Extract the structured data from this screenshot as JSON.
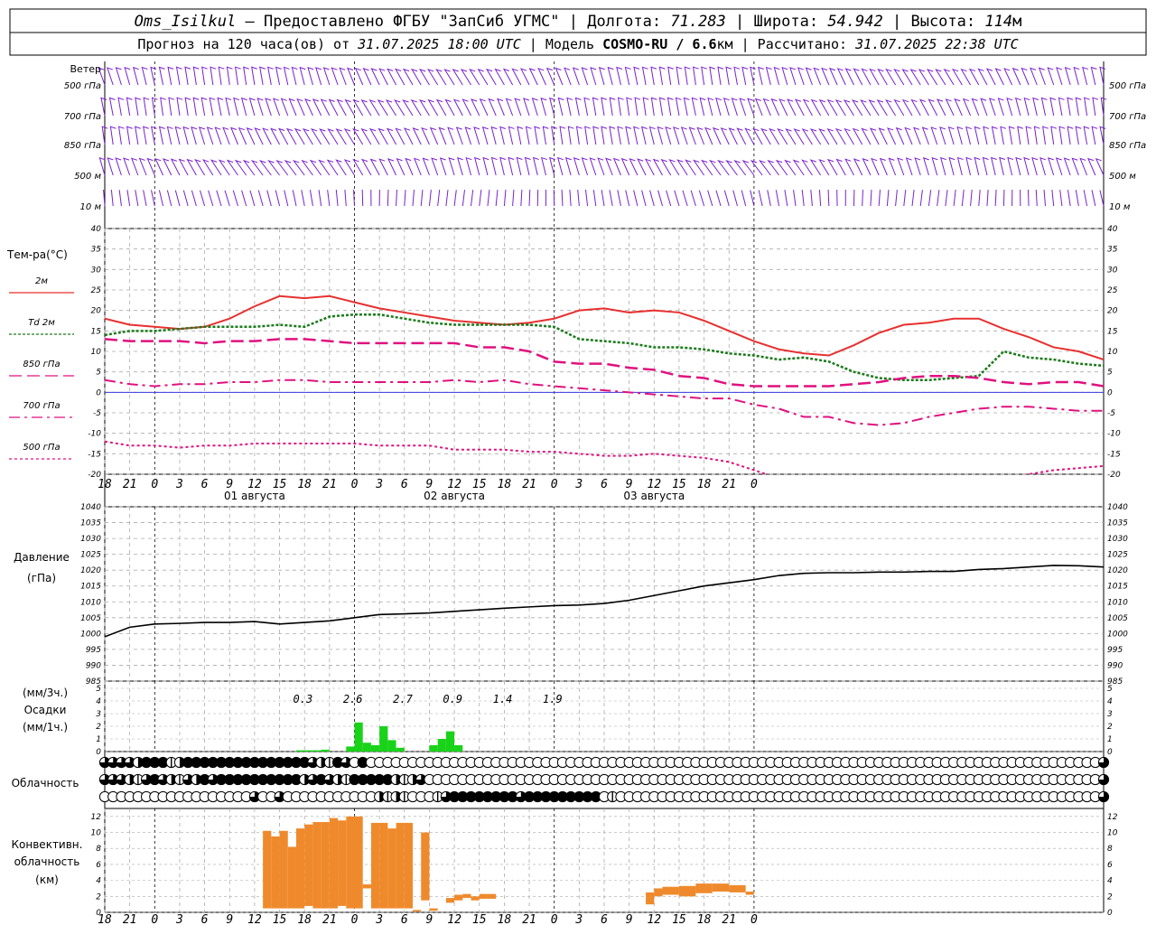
{
  "header": {
    "line1": {
      "station": "Oms_Isilkul",
      "provider": " – Предоставлено ФГБУ \"ЗапСиб УГМС\" | ",
      "lon_label": "Долгота: ",
      "lon_value": "71.283",
      "lat_label": " | Широта: ",
      "lat_value": "54.942",
      "alt_label": " | Высота: ",
      "alt_value": "114",
      "alt_unit": "м"
    },
    "line2": {
      "forecast_label": "Прогноз на 120 часа(ов) от ",
      "forecast_start": "31.07.2025 18:00 UTC",
      "model_label": "  | Модель ",
      "model_name": "COSMO-RU / 6.6",
      "model_unit": "км",
      "calc_label": " | Рассчитано: ",
      "calc_time": "31.07.2025 22:38 UTC"
    }
  },
  "colors": {
    "wind": "#7a1fd0",
    "t2m": "#e83030",
    "td2m": "#1a7a1a",
    "t850": "#e0117f",
    "t700": "#e0117f",
    "t500": "#e0117f",
    "zero_line": "#3a3ae0",
    "pressure": "#000000",
    "precip": "#19d319",
    "convective": "#ef8a2c",
    "grid": "#aaaaaa"
  },
  "time_axis": {
    "ticks": [
      "18",
      "21",
      "0",
      "3",
      "6",
      "9",
      "12",
      "15",
      "18",
      "21",
      "0",
      "3",
      "6",
      "9",
      "12",
      "15",
      "18",
      "21",
      "0",
      "3",
      "6",
      "9",
      "12",
      "15",
      "18",
      "21",
      "0"
    ],
    "day_labels": [
      "01 августа",
      "02 августа",
      "03 августа"
    ]
  },
  "wind_panel": {
    "title": "Ветер",
    "levels": [
      "500 гПа",
      "700 гПа",
      "850 гПа",
      "500 м",
      "10 м"
    ]
  },
  "temp_panel": {
    "title": "Тем-ра(°С)",
    "legend": [
      {
        "label": "2м",
        "style": "solid"
      },
      {
        "label": "Td 2м",
        "style": "dotted"
      },
      {
        "label": "850 гПа",
        "style": "dash"
      },
      {
        "label": "700 гПа",
        "style": "dashdot"
      },
      {
        "label": "500 гПа",
        "style": "fine"
      }
    ]
  },
  "pressure_panel": {
    "title_line1": "Давление",
    "title_line2": "(гПа)"
  },
  "precip_panel": {
    "label_line1": "(мм/3ч.)",
    "label_line2": "Осадки",
    "label_line3": "(мм/1ч.)",
    "totals": [
      "0.3",
      "2.6",
      "2.7",
      "0.9",
      "1.4",
      "1.9"
    ]
  },
  "cloud_panel": {
    "title": "Облачность"
  },
  "conv_panel": {
    "title_line1": "Конвективн.",
    "title_line2": "облачность",
    "title_line3": "(км)"
  },
  "chart_data": [
    {
      "type": "line",
      "title": "Тем-ра(°С)",
      "x_hours": [
        0,
        3,
        6,
        9,
        12,
        15,
        18,
        21,
        24,
        27,
        30,
        33,
        36,
        39,
        42,
        45,
        48,
        51,
        54,
        57,
        60,
        63,
        66,
        69,
        72,
        75,
        78,
        81,
        84,
        87,
        90,
        93,
        96,
        99,
        102,
        105,
        108,
        111,
        114,
        117,
        120
      ],
      "ylim": [
        -20,
        40
      ],
      "yticks": [
        -20,
        -15,
        -10,
        -5,
        0,
        5,
        10,
        15,
        20,
        25,
        30,
        35,
        40
      ],
      "series": [
        {
          "name": "2м",
          "values": [
            18,
            16.5,
            16,
            15.5,
            16,
            18,
            21,
            23.5,
            23,
            23.5,
            22,
            20.5,
            19.5,
            18.5,
            17.5,
            17,
            16.5,
            17,
            18,
            20,
            20.5,
            19.5,
            20,
            19.5,
            17.5,
            15,
            12.5,
            10.5,
            9.5,
            9,
            11.5,
            14.5,
            16.5,
            17,
            18,
            18,
            15.5,
            13.5,
            11,
            10,
            8
          ]
        },
        {
          "name": "Td 2м",
          "values": [
            14,
            15,
            15,
            15.5,
            16,
            16,
            16,
            16.5,
            16,
            18.5,
            19,
            19,
            18,
            17,
            16.5,
            16.5,
            16.5,
            16.5,
            16,
            13,
            12.5,
            12,
            11,
            11,
            10.5,
            9.5,
            9,
            8,
            8.5,
            7.5,
            5,
            3.5,
            3,
            3,
            3.5,
            4,
            10,
            8.5,
            8,
            7,
            6.5
          ]
        },
        {
          "name": "850 гПа",
          "values": [
            13,
            12.5,
            12.5,
            12.5,
            12,
            12.5,
            12.5,
            13,
            13,
            12.5,
            12,
            12,
            12,
            12,
            12,
            11,
            11,
            10,
            7.5,
            7,
            7,
            6,
            5.5,
            4,
            3.5,
            2,
            1.5,
            1.5,
            1.5,
            1.5,
            2,
            2.5,
            3.5,
            4,
            4,
            3.5,
            2.5,
            2,
            2.5,
            2.5,
            1.5
          ]
        },
        {
          "name": "700 гПа",
          "values": [
            3,
            2,
            1.5,
            2,
            2,
            2.5,
            2.5,
            3,
            3,
            2.5,
            2.5,
            2.5,
            2.5,
            2.5,
            3,
            2.5,
            3,
            2,
            1.5,
            1,
            0.5,
            0,
            -0.5,
            -1,
            -1.5,
            -1.5,
            -3,
            -4,
            -6,
            -6,
            -7.5,
            -8,
            -7.5,
            -6,
            -5,
            -4,
            -3.5,
            -3.5,
            -4,
            -4.5,
            -4.5
          ]
        },
        {
          "name": "500 гПа",
          "values": [
            -12,
            -13,
            -13,
            -13.5,
            -13,
            -13,
            -12.5,
            -12.5,
            -12.5,
            -12.5,
            -12.5,
            -13,
            -13,
            -13,
            -14,
            -14,
            -14,
            -14.5,
            -14.5,
            -15,
            -15.5,
            -15.5,
            -15,
            -15.5,
            -16,
            -17,
            -19,
            -21,
            -23,
            -24,
            -24,
            -23.5,
            -23,
            -22.5,
            -22,
            -21.5,
            -21,
            -20,
            -19,
            -18.5,
            -18
          ]
        }
      ]
    },
    {
      "type": "line",
      "title": "Давление",
      "ylabel": "(гПа)",
      "x_hours": [
        0,
        3,
        6,
        9,
        12,
        15,
        18,
        21,
        24,
        27,
        30,
        33,
        36,
        39,
        42,
        45,
        48,
        51,
        54,
        57,
        60,
        63,
        66,
        69,
        72,
        75,
        78,
        81,
        84,
        87,
        90,
        93,
        96,
        99,
        102,
        105,
        108,
        111,
        114,
        117,
        120
      ],
      "ylim": [
        985,
        1040
      ],
      "yticks": [
        985,
        990,
        995,
        1000,
        1005,
        1010,
        1015,
        1020,
        1025,
        1030,
        1035,
        1040
      ],
      "series": [
        {
          "name": "",
          "values": [
            999,
            1002,
            1003,
            1003.2,
            1003.5,
            1003.5,
            1003.8,
            1003,
            1003.5,
            1004,
            1005,
            1006,
            1006.2,
            1006.5,
            1007,
            1007.5,
            1008,
            1008.4,
            1008.8,
            1009,
            1009.5,
            1010.5,
            1012,
            1013.5,
            1015,
            1016,
            1017,
            1018.3,
            1019,
            1019.2,
            1019.2,
            1019.4,
            1019.4,
            1019.6,
            1019.6,
            1020.2,
            1020.5,
            1021,
            1021.5,
            1021.4,
            1021
          ]
        }
      ]
    },
    {
      "type": "bar",
      "title": "Осадки",
      "ylabel": "(мм/1ч.)",
      "x_hours": [
        24,
        25,
        26,
        27,
        28,
        29,
        30,
        31,
        32,
        33,
        34,
        35,
        36,
        37,
        38,
        39,
        40,
        41,
        42,
        43,
        44,
        45,
        46,
        47,
        48,
        49,
        50
      ],
      "ylim": [
        0,
        5
      ],
      "yticks": [
        0,
        1,
        2,
        3,
        4,
        5
      ],
      "values": [
        0.1,
        0.1,
        0.1,
        0.15,
        0,
        0,
        0.4,
        2.3,
        0.7,
        0.5,
        2.0,
        0.9,
        0.3,
        0,
        0,
        0,
        0.5,
        1.0,
        1.6,
        0.5,
        0,
        0,
        0,
        0,
        0,
        0,
        0
      ]
    },
    {
      "type": "bar",
      "title": "Конвективн. облачность (км)",
      "ylim": [
        0,
        13
      ],
      "yticks": [
        0,
        2,
        4,
        6,
        8,
        10,
        12
      ],
      "ranges": [
        {
          "start": 58,
          "end": 59,
          "base": 0.5,
          "top": 10.2
        },
        {
          "start": 59,
          "end": 60,
          "base": 0.5,
          "top": 9.5
        },
        {
          "start": 60,
          "end": 61,
          "base": 0.5,
          "top": 10.2
        },
        {
          "start": 61,
          "end": 62,
          "base": 0.5,
          "top": 8.2
        },
        {
          "start": 62,
          "end": 63,
          "base": 0.5,
          "top": 10.5
        },
        {
          "start": 63,
          "end": 64,
          "base": 0.8,
          "top": 11
        },
        {
          "start": 64,
          "end": 65,
          "base": 0.5,
          "top": 11.3
        },
        {
          "start": 65,
          "end": 66,
          "base": 0.5,
          "top": 11.3
        },
        {
          "start": 66,
          "end": 67,
          "base": 0.5,
          "top": 11.8
        },
        {
          "start": 67,
          "end": 68,
          "base": 0.8,
          "top": 11.5
        },
        {
          "start": 68,
          "end": 69,
          "base": 0.5,
          "top": 12
        },
        {
          "start": 69,
          "end": 70,
          "base": 0.5,
          "top": 12
        },
        {
          "start": 70,
          "end": 71,
          "base": 3,
          "top": 3.5
        },
        {
          "start": 71,
          "end": 72,
          "base": 0.5,
          "top": 11.2
        },
        {
          "start": 72,
          "end": 73,
          "base": 0.5,
          "top": 11.2
        },
        {
          "start": 73,
          "end": 74,
          "base": 0.5,
          "top": 10.5
        },
        {
          "start": 74,
          "end": 75,
          "base": 0.5,
          "top": 11.2
        },
        {
          "start": 75,
          "end": 76,
          "base": 0.5,
          "top": 11.2
        },
        {
          "start": 76,
          "end": 77,
          "base": 0.1,
          "top": 0.3
        },
        {
          "start": 77,
          "end": 78,
          "base": 1.5,
          "top": 10
        },
        {
          "start": 78,
          "end": 79,
          "base": 0.2,
          "top": 0.5
        },
        {
          "start": 80,
          "end": 81,
          "base": 1.2,
          "top": 1.8
        },
        {
          "start": 81,
          "end": 82,
          "base": 1.5,
          "top": 2.2
        },
        {
          "start": 82,
          "end": 83,
          "base": 1.8,
          "top": 2.3
        },
        {
          "start": 83,
          "end": 84,
          "base": 1.5,
          "top": 2
        },
        {
          "start": 84,
          "end": 85,
          "base": 1.7,
          "top": 2.3
        },
        {
          "start": 85,
          "end": 86,
          "base": 1.7,
          "top": 2.3
        },
        {
          "start": 104,
          "end": 105,
          "base": 1,
          "top": 2.5
        },
        {
          "start": 105,
          "end": 106,
          "base": 2,
          "top": 3
        },
        {
          "start": 106,
          "end": 108,
          "base": 2.2,
          "top": 3.2
        },
        {
          "start": 108,
          "end": 110,
          "base": 2,
          "top": 3.3
        },
        {
          "start": 110,
          "end": 112,
          "base": 2.4,
          "top": 3.6
        },
        {
          "start": 112,
          "end": 114,
          "base": 2.6,
          "top": 3.6
        },
        {
          "start": 114,
          "end": 116,
          "base": 2.5,
          "top": 3.4
        },
        {
          "start": 116,
          "end": 117,
          "base": 2.2,
          "top": 2.6
        }
      ]
    }
  ],
  "cloud_rows": [
    [
      3,
      3,
      3,
      3,
      2,
      4,
      4,
      4,
      1,
      2,
      4,
      4,
      4,
      4,
      4,
      4,
      4,
      4,
      4,
      4,
      4,
      4,
      4,
      4,
      4,
      3,
      2,
      1,
      4,
      3,
      0,
      4,
      0,
      0,
      0,
      0,
      0,
      0,
      0,
      0,
      0,
      0,
      0,
      0,
      0,
      0,
      0,
      0,
      0,
      0,
      0,
      0,
      0,
      0,
      0,
      0,
      0,
      0,
      0,
      0,
      0,
      0,
      0,
      0,
      0,
      0,
      0,
      0,
      0,
      0,
      0,
      0,
      0,
      0,
      0,
      0,
      0,
      0,
      0,
      0,
      0,
      0,
      0,
      0,
      0,
      0,
      0,
      0,
      0,
      0,
      0,
      0,
      0,
      0,
      0,
      0,
      0,
      0,
      0,
      0,
      0,
      0,
      0,
      0,
      0,
      0,
      0,
      0,
      0,
      0,
      0,
      0,
      0,
      0,
      0,
      0,
      0,
      0,
      0,
      0,
      3
    ],
    [
      3,
      3,
      3,
      2,
      1,
      3,
      4,
      3,
      2,
      1,
      3,
      2,
      4,
      3,
      4,
      4,
      4,
      4,
      4,
      4,
      4,
      4,
      4,
      4,
      2,
      3,
      4,
      3,
      2,
      1,
      4,
      4,
      4,
      4,
      4,
      2,
      1,
      2,
      3,
      0,
      0,
      0,
      0,
      0,
      0,
      0,
      0,
      0,
      0,
      0,
      0,
      0,
      0,
      0,
      0,
      0,
      0,
      0,
      0,
      0,
      0,
      0,
      0,
      0,
      0,
      0,
      0,
      0,
      0,
      0,
      0,
      0,
      0,
      0,
      0,
      0,
      0,
      0,
      0,
      0,
      0,
      0,
      0,
      0,
      0,
      0,
      0,
      0,
      0,
      0,
      0,
      0,
      0,
      0,
      0,
      0,
      0,
      0,
      0,
      0,
      0,
      0,
      0,
      0,
      0,
      0,
      0,
      0,
      0,
      0,
      0,
      0,
      0,
      0,
      0,
      0,
      0,
      0,
      0,
      0,
      3
    ],
    [
      0,
      0,
      0,
      0,
      0,
      0,
      0,
      0,
      0,
      0,
      0,
      0,
      0,
      0,
      0,
      0,
      0,
      0,
      3,
      0,
      0,
      3,
      0,
      0,
      0,
      0,
      0,
      0,
      0,
      0,
      0,
      0,
      0,
      2,
      1,
      2,
      1,
      0,
      0,
      0,
      1,
      3,
      4,
      4,
      4,
      4,
      4,
      4,
      4,
      4,
      3,
      4,
      4,
      4,
      4,
      4,
      4,
      4,
      4,
      4,
      0,
      1,
      0,
      0,
      0,
      0,
      0,
      0,
      0,
      0,
      0,
      0,
      0,
      0,
      0,
      0,
      0,
      0,
      0,
      0,
      0,
      0,
      0,
      0,
      0,
      0,
      0,
      0,
      0,
      0,
      0,
      0,
      0,
      0,
      0,
      0,
      0,
      0,
      0,
      0,
      0,
      0,
      0,
      0,
      0,
      0,
      0,
      0,
      0,
      0,
      0,
      0,
      0,
      0,
      0,
      0,
      0,
      0,
      0,
      0,
      3
    ]
  ]
}
